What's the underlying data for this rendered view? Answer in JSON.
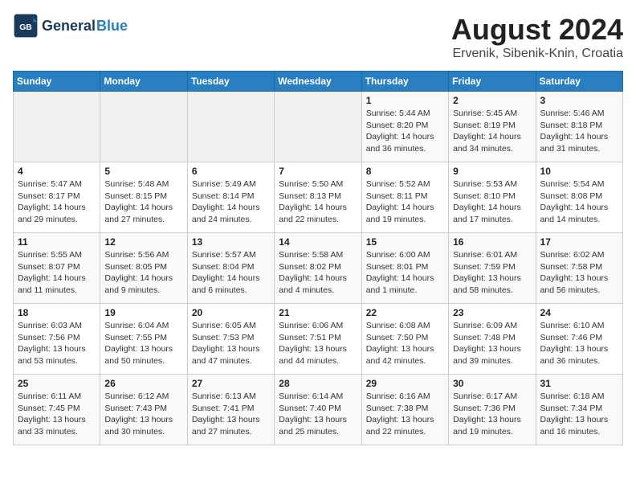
{
  "header": {
    "logo_line1": "General",
    "logo_line2": "Blue",
    "month_year": "August 2024",
    "location": "Ervenik, Sibenik-Knin, Croatia"
  },
  "days_of_week": [
    "Sunday",
    "Monday",
    "Tuesday",
    "Wednesday",
    "Thursday",
    "Friday",
    "Saturday"
  ],
  "weeks": [
    [
      {
        "day": "",
        "info": ""
      },
      {
        "day": "",
        "info": ""
      },
      {
        "day": "",
        "info": ""
      },
      {
        "day": "",
        "info": ""
      },
      {
        "day": "1",
        "info": "Sunrise: 5:44 AM\nSunset: 8:20 PM\nDaylight: 14 hours\nand 36 minutes."
      },
      {
        "day": "2",
        "info": "Sunrise: 5:45 AM\nSunset: 8:19 PM\nDaylight: 14 hours\nand 34 minutes."
      },
      {
        "day": "3",
        "info": "Sunrise: 5:46 AM\nSunset: 8:18 PM\nDaylight: 14 hours\nand 31 minutes."
      }
    ],
    [
      {
        "day": "4",
        "info": "Sunrise: 5:47 AM\nSunset: 8:17 PM\nDaylight: 14 hours\nand 29 minutes."
      },
      {
        "day": "5",
        "info": "Sunrise: 5:48 AM\nSunset: 8:15 PM\nDaylight: 14 hours\nand 27 minutes."
      },
      {
        "day": "6",
        "info": "Sunrise: 5:49 AM\nSunset: 8:14 PM\nDaylight: 14 hours\nand 24 minutes."
      },
      {
        "day": "7",
        "info": "Sunrise: 5:50 AM\nSunset: 8:13 PM\nDaylight: 14 hours\nand 22 minutes."
      },
      {
        "day": "8",
        "info": "Sunrise: 5:52 AM\nSunset: 8:11 PM\nDaylight: 14 hours\nand 19 minutes."
      },
      {
        "day": "9",
        "info": "Sunrise: 5:53 AM\nSunset: 8:10 PM\nDaylight: 14 hours\nand 17 minutes."
      },
      {
        "day": "10",
        "info": "Sunrise: 5:54 AM\nSunset: 8:08 PM\nDaylight: 14 hours\nand 14 minutes."
      }
    ],
    [
      {
        "day": "11",
        "info": "Sunrise: 5:55 AM\nSunset: 8:07 PM\nDaylight: 14 hours\nand 11 minutes."
      },
      {
        "day": "12",
        "info": "Sunrise: 5:56 AM\nSunset: 8:05 PM\nDaylight: 14 hours\nand 9 minutes."
      },
      {
        "day": "13",
        "info": "Sunrise: 5:57 AM\nSunset: 8:04 PM\nDaylight: 14 hours\nand 6 minutes."
      },
      {
        "day": "14",
        "info": "Sunrise: 5:58 AM\nSunset: 8:02 PM\nDaylight: 14 hours\nand 4 minutes."
      },
      {
        "day": "15",
        "info": "Sunrise: 6:00 AM\nSunset: 8:01 PM\nDaylight: 14 hours\nand 1 minute."
      },
      {
        "day": "16",
        "info": "Sunrise: 6:01 AM\nSunset: 7:59 PM\nDaylight: 13 hours\nand 58 minutes."
      },
      {
        "day": "17",
        "info": "Sunrise: 6:02 AM\nSunset: 7:58 PM\nDaylight: 13 hours\nand 56 minutes."
      }
    ],
    [
      {
        "day": "18",
        "info": "Sunrise: 6:03 AM\nSunset: 7:56 PM\nDaylight: 13 hours\nand 53 minutes."
      },
      {
        "day": "19",
        "info": "Sunrise: 6:04 AM\nSunset: 7:55 PM\nDaylight: 13 hours\nand 50 minutes."
      },
      {
        "day": "20",
        "info": "Sunrise: 6:05 AM\nSunset: 7:53 PM\nDaylight: 13 hours\nand 47 minutes."
      },
      {
        "day": "21",
        "info": "Sunrise: 6:06 AM\nSunset: 7:51 PM\nDaylight: 13 hours\nand 44 minutes."
      },
      {
        "day": "22",
        "info": "Sunrise: 6:08 AM\nSunset: 7:50 PM\nDaylight: 13 hours\nand 42 minutes."
      },
      {
        "day": "23",
        "info": "Sunrise: 6:09 AM\nSunset: 7:48 PM\nDaylight: 13 hours\nand 39 minutes."
      },
      {
        "day": "24",
        "info": "Sunrise: 6:10 AM\nSunset: 7:46 PM\nDaylight: 13 hours\nand 36 minutes."
      }
    ],
    [
      {
        "day": "25",
        "info": "Sunrise: 6:11 AM\nSunset: 7:45 PM\nDaylight: 13 hours\nand 33 minutes."
      },
      {
        "day": "26",
        "info": "Sunrise: 6:12 AM\nSunset: 7:43 PM\nDaylight: 13 hours\nand 30 minutes."
      },
      {
        "day": "27",
        "info": "Sunrise: 6:13 AM\nSunset: 7:41 PM\nDaylight: 13 hours\nand 27 minutes."
      },
      {
        "day": "28",
        "info": "Sunrise: 6:14 AM\nSunset: 7:40 PM\nDaylight: 13 hours\nand 25 minutes."
      },
      {
        "day": "29",
        "info": "Sunrise: 6:16 AM\nSunset: 7:38 PM\nDaylight: 13 hours\nand 22 minutes."
      },
      {
        "day": "30",
        "info": "Sunrise: 6:17 AM\nSunset: 7:36 PM\nDaylight: 13 hours\nand 19 minutes."
      },
      {
        "day": "31",
        "info": "Sunrise: 6:18 AM\nSunset: 7:34 PM\nDaylight: 13 hours\nand 16 minutes."
      }
    ]
  ]
}
